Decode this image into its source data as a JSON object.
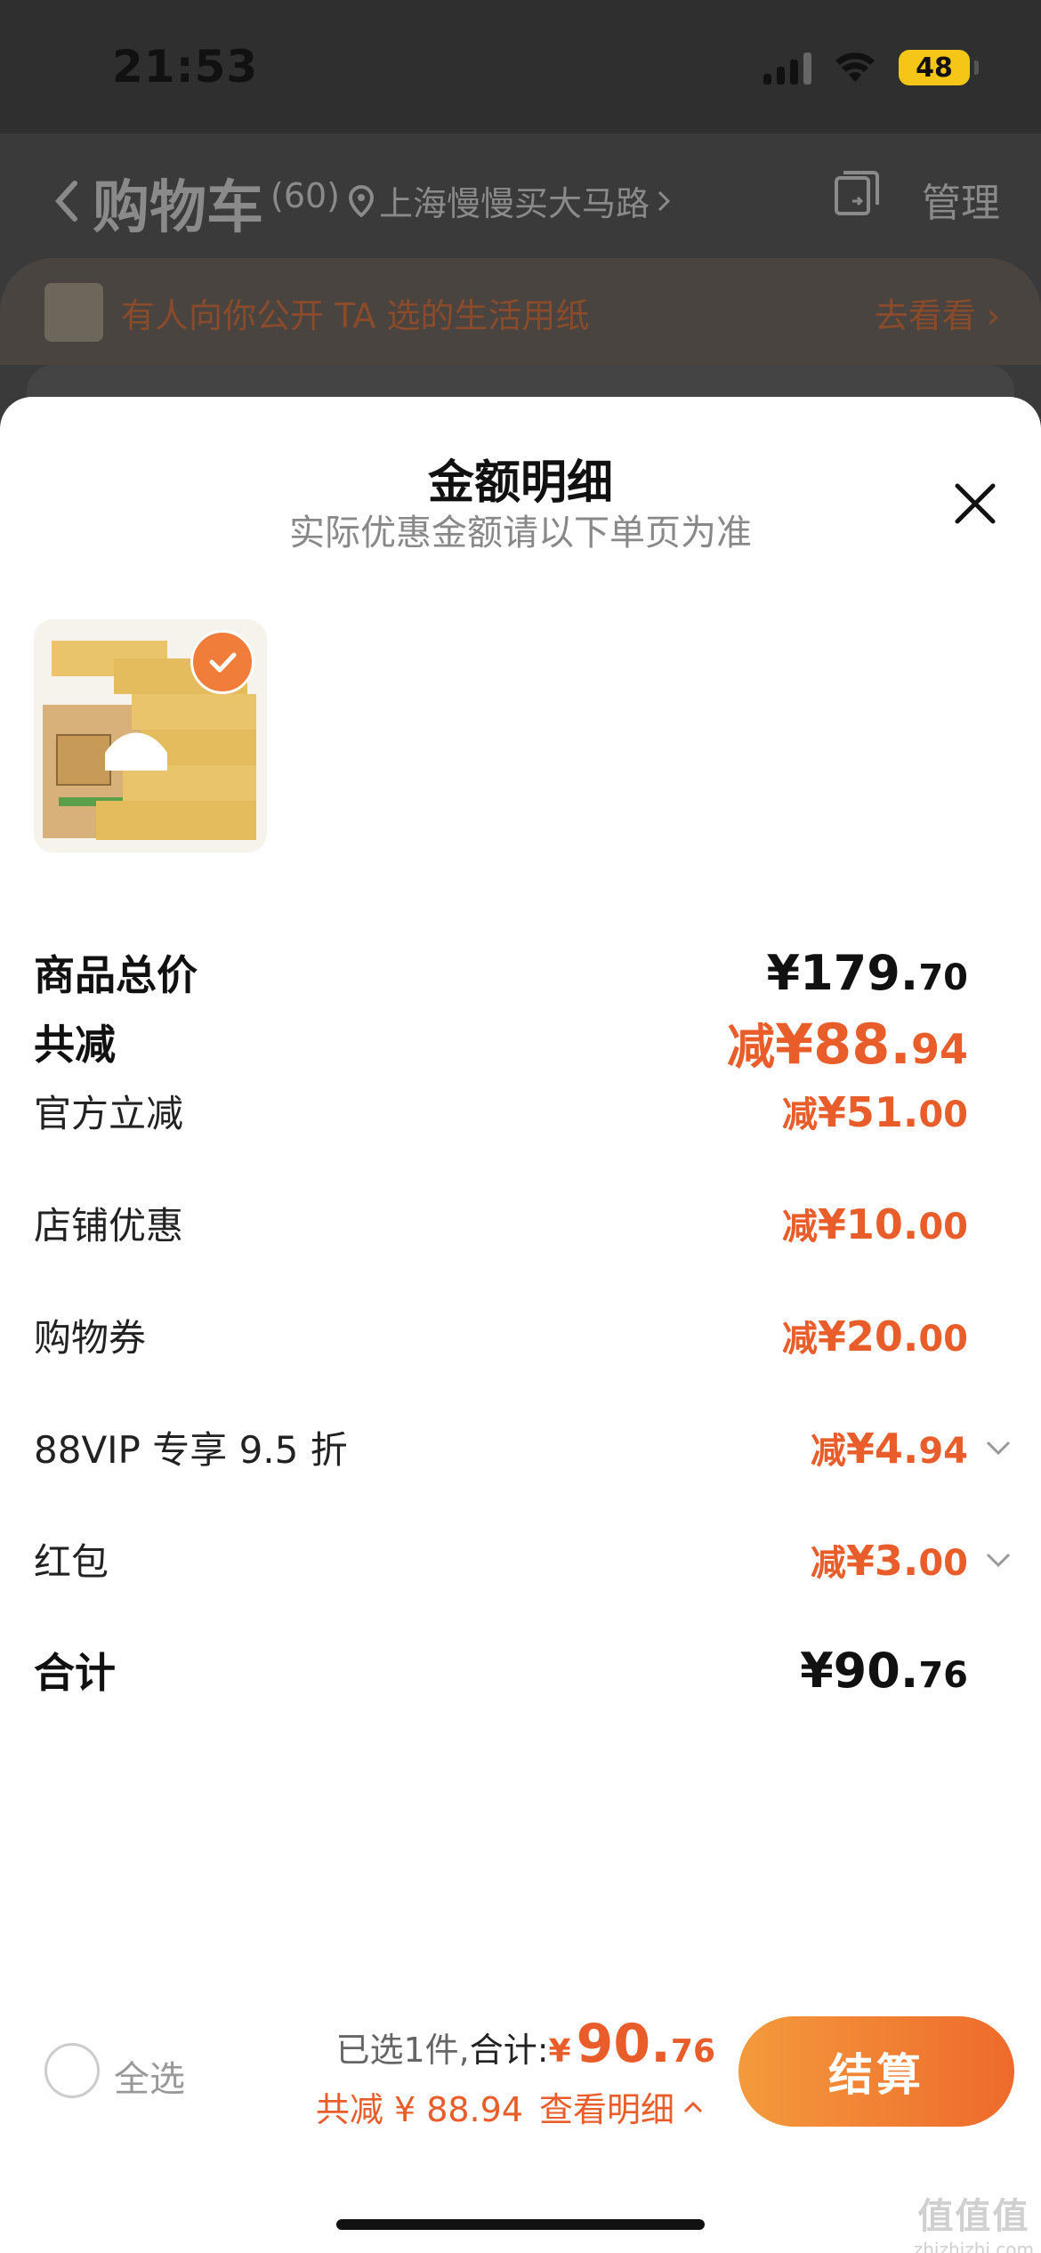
{
  "status_bar": {
    "time": "21:53",
    "battery": "48"
  },
  "header": {
    "back_icon": "chevron-left-icon",
    "title": "购物车",
    "count": "(60)",
    "location": "上海慢慢买大马路",
    "manage": "管理"
  },
  "promo": {
    "text": "有人向你公开 TA 选的生活用纸",
    "link": "去看看"
  },
  "sheet": {
    "title": "金额明细",
    "subtitle": "实际优惠金额请以下单页为准"
  },
  "rows": [
    {
      "label": "商品总价",
      "prefix": "",
      "int": "¥179.",
      "dec": "70"
    },
    {
      "label": "共减",
      "prefix": "减 ",
      "int": "¥88.",
      "dec": "94"
    },
    {
      "label": "官方立减",
      "prefix": "减 ",
      "int": "¥51.",
      "dec": "00"
    },
    {
      "label": "店铺优惠",
      "prefix": "减 ",
      "int": "¥10.",
      "dec": "00"
    },
    {
      "label": "购物券",
      "prefix": "减 ",
      "int": "¥20.",
      "dec": "00"
    },
    {
      "label": "88VIP 专享 9.5 折",
      "prefix": "减 ",
      "int": "¥4.",
      "dec": "94"
    },
    {
      "label": "红包",
      "prefix": "减 ",
      "int": "¥3.",
      "dec": "00"
    },
    {
      "label": "合计",
      "prefix": "",
      "int": "¥90.",
      "dec": "76"
    }
  ],
  "bottom": {
    "select_all": "全选",
    "selected": "已选1件,",
    "total_label": " 合计:",
    "currency": "¥",
    "total_int": "90.",
    "total_dec": "76",
    "discount": "共减 ¥ 88.94",
    "detail": "查看明细",
    "checkout": "结算"
  },
  "watermark": {
    "line1": "值值值",
    "line2": "zhizhizhi.com"
  },
  "colors": {
    "accent": "#e85d2a",
    "checkout_start": "#f49a3c",
    "checkout_end": "#ee6a2c"
  }
}
